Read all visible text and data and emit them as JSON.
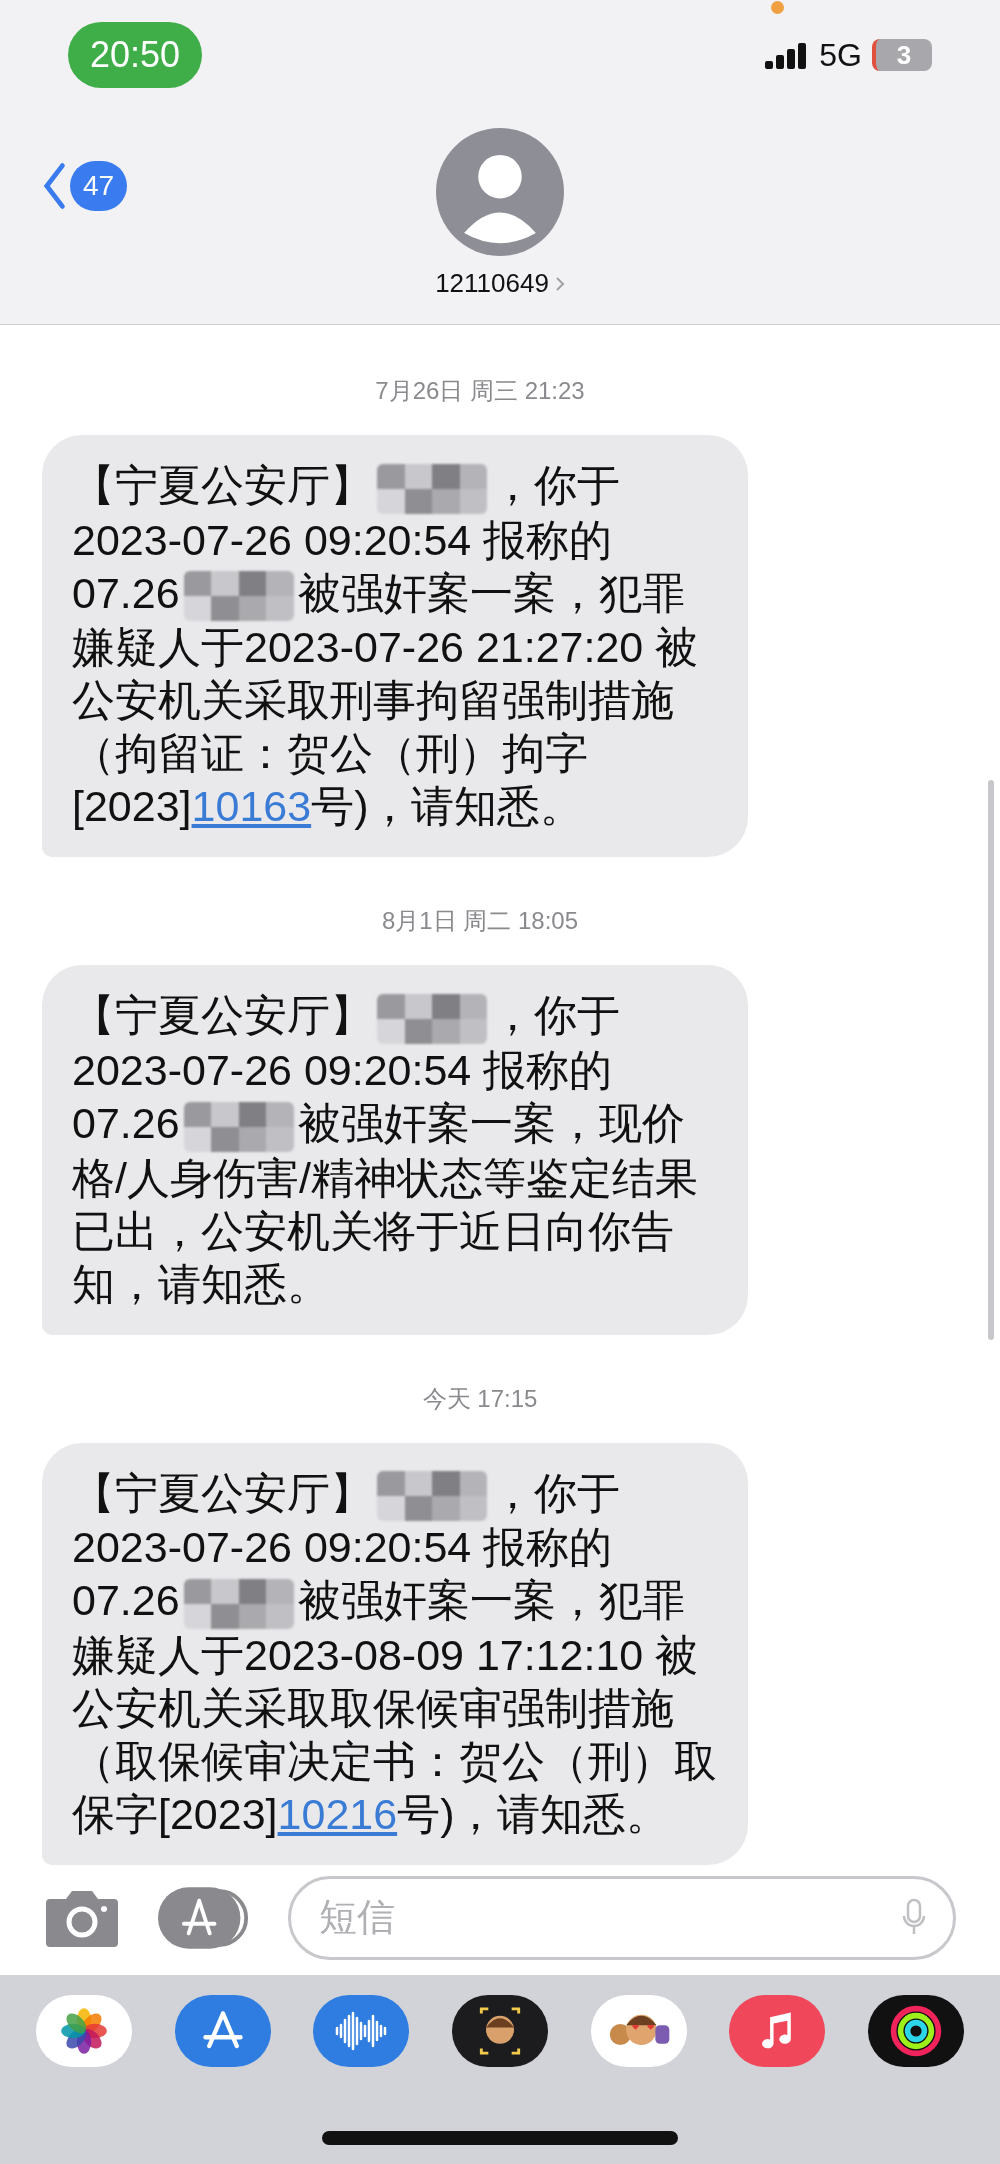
{
  "status_bar": {
    "time": "20:50",
    "network": "5G",
    "battery": "3"
  },
  "header": {
    "back_count": "47",
    "contact": "12110649"
  },
  "thread": [
    {
      "timestamp": "7月26日 周三 21:23",
      "segments": [
        {
          "kind": "text",
          "text": "【宁夏公安厅】"
        },
        {
          "kind": "redacted"
        },
        {
          "kind": "text",
          "text": "，你于2023-07-26 09:20:54 报称的07.26"
        },
        {
          "kind": "redacted"
        },
        {
          "kind": "text",
          "text": "被强奸案一案，犯罪嫌疑人于2023-07-26 21:27:20 被公安机关采取刑事拘留强制措施（拘留证：贺公（刑）拘字[2023]"
        },
        {
          "kind": "link",
          "text": "10163"
        },
        {
          "kind": "text",
          "text": "号)，请知悉。"
        }
      ]
    },
    {
      "timestamp": "8月1日 周二 18:05",
      "segments": [
        {
          "kind": "text",
          "text": "【宁夏公安厅】"
        },
        {
          "kind": "redacted"
        },
        {
          "kind": "text",
          "text": "，你于2023-07-26 09:20:54 报称的07.26"
        },
        {
          "kind": "redacted"
        },
        {
          "kind": "text",
          "text": "被强奸案一案，现价格/人身伤害/精神状态等鉴定结果已出，公安机关将于近日向你告知，请知悉。"
        }
      ]
    },
    {
      "timestamp": "今天 17:15",
      "segments": [
        {
          "kind": "text",
          "text": "【宁夏公安厅】"
        },
        {
          "kind": "redacted"
        },
        {
          "kind": "text",
          "text": "，你于2023-07-26 09:20:54 报称的07.26"
        },
        {
          "kind": "redacted"
        },
        {
          "kind": "text",
          "text": "被强奸案一案，犯罪嫌疑人于2023-08-09 17:12:10 被公安机关采取取保候审强制措施（取保候审决定书：贺公（刑）取保字[2023]"
        },
        {
          "kind": "link",
          "text": "10216"
        },
        {
          "kind": "text",
          "text": "号)，请知悉。"
        }
      ]
    }
  ],
  "composer": {
    "placeholder": "短信"
  },
  "app_drawer": [
    {
      "kind": "photos"
    },
    {
      "kind": "appstore"
    },
    {
      "kind": "audio"
    },
    {
      "kind": "memoji"
    },
    {
      "kind": "stickers"
    },
    {
      "kind": "music"
    },
    {
      "kind": "activity"
    }
  ]
}
